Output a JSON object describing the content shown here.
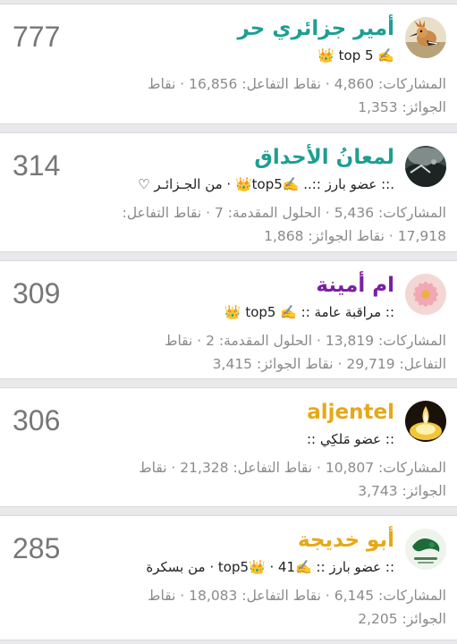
{
  "colors": {
    "name_teal": "#2aa198",
    "name_purple": "#7b1fa2",
    "name_gold": "#e6a817",
    "score_gray": "#777777",
    "stats_gray": "#8a8a8a"
  },
  "members": [
    {
      "name": "أمير جزائري حر",
      "name_color": "#1f9e93",
      "score": "777",
      "title": "✍️ top 5 👑",
      "stats_line1": "المشاركات: 4,860 · نقاط التفاعل: 16,856 · نقاط",
      "stats_line2": "الجوائز: 1,353",
      "avatar_icon": "hoopoe-bird-icon"
    },
    {
      "name": "لمعانُ الأحداق",
      "name_color": "#1f9e93",
      "score": "314",
      "title": ".:: عضو بارز ::..  ✍️top5👑 · من الجـزائـر ♡",
      "stats_line1": "المشاركات: 5,436 · الحلول المقدمة: 7 · نقاط التفاعل:",
      "stats_line2": "17,918 · نقاط الجوائز: 1,868",
      "avatar_icon": "dark-landscape-icon"
    },
    {
      "name": "ام أمينة",
      "name_color": "#7b1fa2",
      "score": "309",
      "title": ":: مراقبة عامة ::  ✍️ top5 👑",
      "stats_line1": "المشاركات: 13,819 · الحلول المقدمة: 2 · نقاط",
      "stats_line2": "التفاعل: 29,719 · نقاط الجوائز: 3,415",
      "avatar_icon": "pink-flower-icon"
    },
    {
      "name": "aljentel",
      "name_color": "#e6a817",
      "score": "306",
      "title": ":: عضو مَلكِي ::",
      "stats_line1": "المشاركات: 10,807 · نقاط التفاعل: 21,328 · نقاط",
      "stats_line2": "الجوائز: 3,743",
      "avatar_icon": "candle-flame-icon"
    },
    {
      "name": "أبو خديجة",
      "name_color": "#e6a817",
      "score": "285",
      "title": ":: عضو بارز ::  ✍️top5👑 · 41 · من بسكرة",
      "stats_line1": "المشاركات: 6,145 · نقاط التفاعل: 18,083 · نقاط",
      "stats_line2": "الجوائز: 2,205",
      "avatar_icon": "green-emblem-icon"
    }
  ]
}
